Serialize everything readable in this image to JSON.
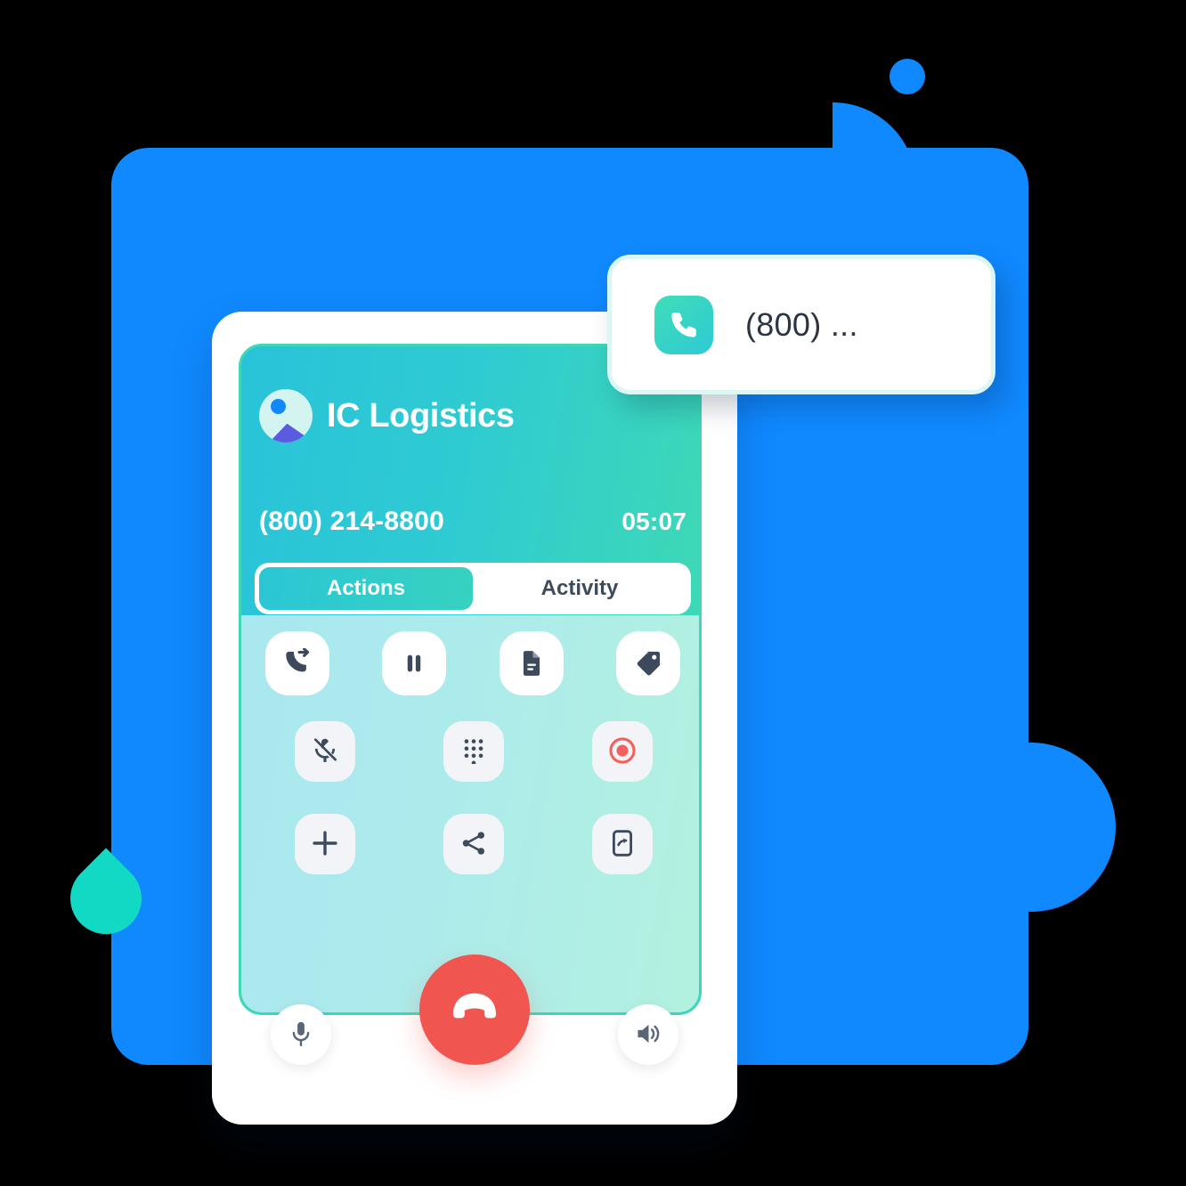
{
  "illustration": {
    "title": "Active call widget illustration",
    "colors": {
      "brand_blue": "#1089FF",
      "teal_start": "#29C3D9",
      "teal_end": "#41DCAF",
      "accent_teal": "#12D9C4",
      "end_call_red": "#F0554F",
      "record_red": "#F4615C",
      "icon_dark": "#3D4A5C",
      "control_bg": "#F2F4F8"
    }
  },
  "background": {
    "dot": "decorative-dot",
    "quarter": "decorative-quarter-circle",
    "panel": "decorative-blue-panel",
    "circle": "decorative-blue-circle",
    "leaf": "decorative-teal-leaf"
  },
  "call_panel": {
    "brand_name": "IC Logistics",
    "avatar_icon": "image-placeholder-icon",
    "phone_number": "(800) 214-8800",
    "timer": "05:07",
    "tabs": [
      {
        "label": "Actions",
        "active": true
      },
      {
        "label": "Activity",
        "active": false
      }
    ],
    "actions": [
      {
        "icon": "call-transfer-icon",
        "label": "Transfer"
      },
      {
        "icon": "pause-icon",
        "label": "Hold"
      },
      {
        "icon": "notes-icon",
        "label": "Notes"
      },
      {
        "icon": "tag-icon",
        "label": "Tag"
      }
    ]
  },
  "controls": [
    {
      "icon": "mic-off-icon",
      "label": "Mute"
    },
    {
      "icon": "dialpad-icon",
      "label": "Keypad"
    },
    {
      "icon": "record-icon",
      "label": "Record"
    },
    {
      "icon": "plus-icon",
      "label": "Add call"
    },
    {
      "icon": "share-icon",
      "label": "Share"
    },
    {
      "icon": "transfer-to-device-icon",
      "label": "Move call"
    }
  ],
  "bottom_bar": {
    "mic": {
      "icon": "microphone-icon",
      "label": "Microphone"
    },
    "end_call": {
      "icon": "end-call-icon",
      "label": "End call"
    },
    "speaker": {
      "icon": "speaker-icon",
      "label": "Speaker"
    }
  },
  "toast": {
    "icon": "phone-icon",
    "text": "(800) ..."
  }
}
